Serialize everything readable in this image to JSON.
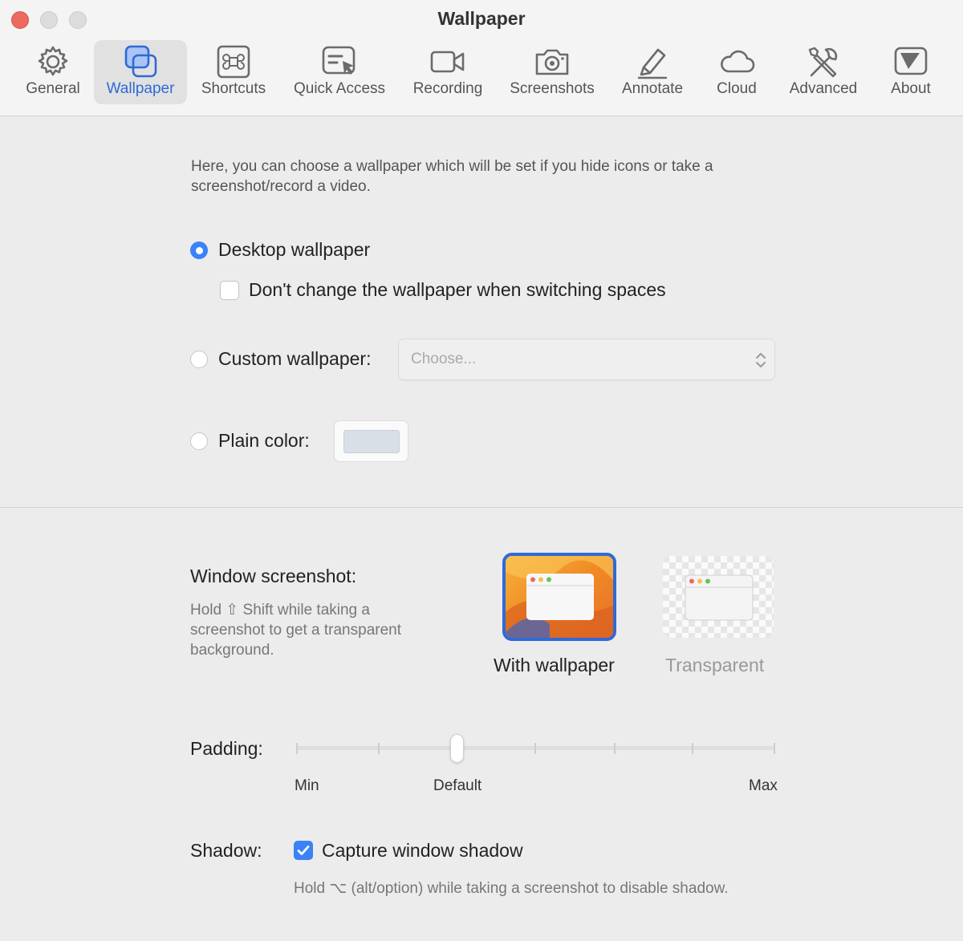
{
  "window": {
    "title": "Wallpaper"
  },
  "toolbar": {
    "tabs": [
      {
        "label": "General",
        "icon": "gear-icon"
      },
      {
        "label": "Wallpaper",
        "icon": "wallpaper-icon",
        "active": true
      },
      {
        "label": "Shortcuts",
        "icon": "command-icon"
      },
      {
        "label": "Quick Access",
        "icon": "quick-access-icon"
      },
      {
        "label": "Recording",
        "icon": "video-camera-icon"
      },
      {
        "label": "Screenshots",
        "icon": "camera-icon"
      },
      {
        "label": "Annotate",
        "icon": "pen-icon"
      },
      {
        "label": "Cloud",
        "icon": "cloud-icon"
      },
      {
        "label": "Advanced",
        "icon": "tools-icon"
      },
      {
        "label": "About",
        "icon": "about-icon"
      }
    ]
  },
  "wallpaper": {
    "description": "Here, you can choose a wallpaper which will be set if you hide icons or take a screenshot/record a video.",
    "desktop_label": "Desktop wallpaper",
    "desktop_selected": true,
    "no_change_label": "Don't change the wallpaper when switching spaces",
    "no_change_checked": false,
    "custom_label": "Custom wallpaper:",
    "custom_placeholder": "Choose...",
    "plain_label": "Plain color:",
    "plain_color": "#d9dfe7"
  },
  "window_screenshot": {
    "title": "Window screenshot:",
    "hint": "Hold ⇧ Shift while taking a screenshot to get a transparent background.",
    "options": [
      {
        "label": "With wallpaper",
        "selected": true
      },
      {
        "label": "Transparent",
        "selected": false
      }
    ]
  },
  "padding": {
    "label": "Padding:",
    "min_label": "Min",
    "default_label": "Default",
    "max_label": "Max",
    "value_fraction": 0.33
  },
  "shadow": {
    "label": "Shadow:",
    "checkbox_label": "Capture window shadow",
    "checked": true,
    "hint": "Hold ⌥ (alt/option) while taking a screenshot to disable shadow."
  },
  "colors": {
    "accent": "#3b82f6",
    "close": "#ed6a5e",
    "active_tab_text": "#2f6ad6"
  }
}
